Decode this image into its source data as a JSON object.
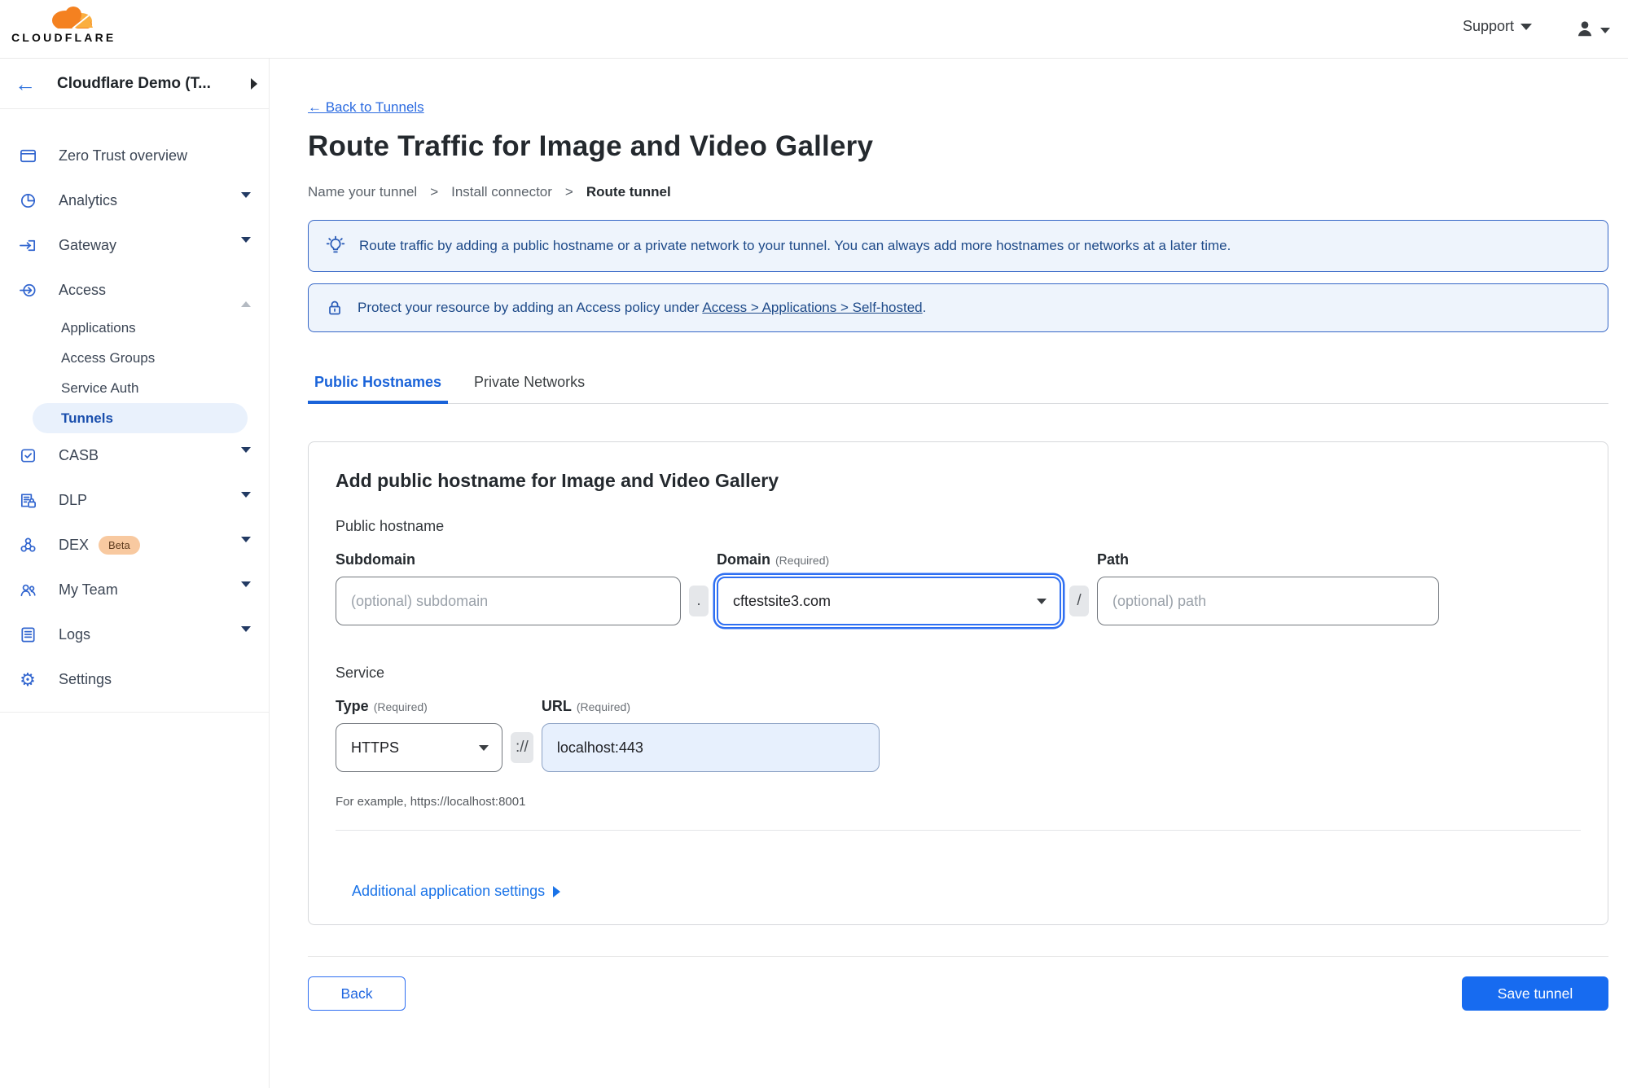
{
  "colors": {
    "accent_blue": "#176bf0",
    "link_blue": "#2a6ae0",
    "active_nav_blue": "#1a4fad",
    "banner_border_blue": "#3566c6",
    "banner_bg_blue": "#eef4fc",
    "banner_text_blue": "#1e4a89",
    "url_field_bg": "#e7f0fd",
    "beta_badge_bg": "#f8c9a0",
    "brand_orange": "#f48120"
  },
  "header": {
    "logo_text": "CLOUDFLARE",
    "logo_icon": "cloudflare-cloud-icon",
    "support_label": "Support",
    "user_icon": "user-icon"
  },
  "sidebar": {
    "back_arrow": "←",
    "account_name": "Cloudflare Demo (T...",
    "items": [
      {
        "label": "Zero Trust overview",
        "icon": "window-icon"
      },
      {
        "label": "Analytics",
        "icon": "pie-chart-icon"
      },
      {
        "label": "Gateway",
        "icon": "gateway-icon"
      },
      {
        "label": "Access",
        "icon": "access-login-icon"
      },
      {
        "label": "CASB",
        "icon": "checkbox-sync-icon"
      },
      {
        "label": "DLP",
        "icon": "document-lock-icon"
      },
      {
        "label": "DEX",
        "icon": "network-nodes-icon",
        "badge": "Beta"
      },
      {
        "label": "My Team",
        "icon": "people-icon"
      },
      {
        "label": "Logs",
        "icon": "log-list-icon"
      },
      {
        "label": "Settings",
        "icon": "gear-icon",
        "gear_glyph": "⚙"
      }
    ],
    "access_sub_items": [
      {
        "label": "Applications"
      },
      {
        "label": "Access Groups"
      },
      {
        "label": "Service Auth"
      },
      {
        "label": "Tunnels",
        "active": true
      }
    ]
  },
  "main": {
    "back_link": "← Back to Tunnels",
    "title": "Route Traffic for Image and Video Gallery",
    "breadcrumb": {
      "step1": "Name your tunnel",
      "step2": "Install connector",
      "step3": "Route tunnel",
      "separator": ">"
    },
    "banners": {
      "tip_icon": "lightbulb-icon",
      "tip_text": "Route traffic by adding a public hostname or a private network to your tunnel. You can always add more hostnames or networks at a later time.",
      "protect_icon": "lock-icon",
      "protect_prefix": "Protect your resource by adding an Access policy under ",
      "protect_link": "Access > Applications > Self-hosted",
      "protect_suffix": "."
    },
    "tabs": {
      "public_hostnames": "Public Hostnames",
      "private_networks": "Private Networks"
    },
    "form": {
      "heading": "Add public hostname for Image and Video Gallery",
      "public_hostname_label": "Public hostname",
      "subdomain_label": "Subdomain",
      "subdomain_placeholder": "(optional) subdomain",
      "dot_separator": ".",
      "domain_label": "Domain",
      "required_note": "(Required)",
      "domain_value": "cftestsite3.com",
      "slash_separator": "/",
      "path_label": "Path",
      "path_placeholder": "(optional) path",
      "service_label": "Service",
      "type_label": "Type",
      "type_value": "HTTPS",
      "scheme_separator": "://",
      "url_label": "URL",
      "url_value": "localhost:443",
      "example_text": "For example, https://localhost:8001",
      "additional_settings_label": "Additional application settings"
    },
    "footer": {
      "back_label": "Back",
      "save_label": "Save tunnel"
    }
  }
}
